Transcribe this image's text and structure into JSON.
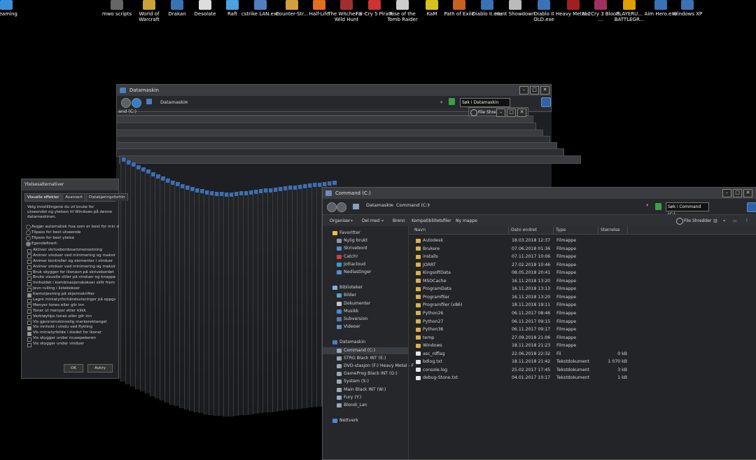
{
  "desktop_icons": [
    {
      "label": "treaming",
      "color": "#3a8fd9"
    },
    {
      "label": "mwo scripts",
      "color": "#666666"
    },
    {
      "label": "World of Warcraft",
      "color": "#c9a23a"
    },
    {
      "label": "Drakan",
      "color": "#3a73b5"
    },
    {
      "label": "Desolate",
      "color": "#dddddd"
    },
    {
      "label": "Raft",
      "color": "#4aa3df"
    },
    {
      "label": "cstrike LAN.exe",
      "color": "#5080c0"
    },
    {
      "label": "Counter-Str...",
      "color": "#d0a040"
    },
    {
      "label": "Half-Life",
      "color": "#e07020"
    },
    {
      "label": "The Witcher 3 - Wild Hunt",
      "color": "#a03030"
    },
    {
      "label": "Far Cry 5 Pirate",
      "color": "#cc3333"
    },
    {
      "label": "Rise of the Tomb Raider",
      "color": "#cccccc"
    },
    {
      "label": "KaM",
      "color": "#d8c020"
    },
    {
      "label": "Path of Exile",
      "color": "#c86020"
    },
    {
      "label": "Diablo II.exe",
      "color": "#3a73b5"
    },
    {
      "label": "Hunt Showdown",
      "color": "#bbbbbb"
    },
    {
      "label": "Diablo II OLD.exe",
      "color": "#3a73b5"
    },
    {
      "label": "Heavy Metal 2",
      "color": "#a02020"
    },
    {
      "label": "Far Cry 3 Blood ...",
      "color": "#a03060"
    },
    {
      "label": "PLAYERU... BATTLEGR...",
      "color": "#e0a000"
    },
    {
      "label": "Aim Hero.exe",
      "color": "#3a73b5"
    },
    {
      "label": "Windows XP",
      "color": "#3a73b5"
    }
  ],
  "performance_dialog": {
    "title": "Ytelsesalternativer",
    "tabs": [
      "Visuelle effekter",
      "Avansert",
      "Datakjøringsforhin"
    ],
    "description": "Velg innstillingene du vil bruke for utseendet og ytelsen til Windows på denne datamaskinen.",
    "radios": [
      "Avgjør automatisk hva som er best for min d",
      "Tilpass for best utseende",
      "Tilpass for best ytelse",
      "Egendefinert:"
    ],
    "options": [
      {
        "label": "Aktiver skrivebordssammensetning",
        "checked": false
      },
      {
        "label": "Animer vinduer ved minimering og maksimering",
        "checked": false
      },
      {
        "label": "Animer kontroller og elementer i vinduer",
        "checked": false
      },
      {
        "label": "Animer vinduer ved minimering og maksimering",
        "checked": false
      },
      {
        "label": "Bruk skygger for ikonavn på skrivebordet",
        "checked": false
      },
      {
        "label": "Bruke visuelle stiler på vinduer og knapper",
        "checked": false
      },
      {
        "label": "Innholdet i kombinasjonsbokser sklîr frem",
        "checked": false
      },
      {
        "label": "Jevn rulling i listebokser",
        "checked": false
      },
      {
        "label": "Kantutjevning på skjermskrifter",
        "checked": true
      },
      {
        "label": "Lagre miniatyrforhåndsvisninger på oppgave",
        "checked": false
      },
      {
        "label": "Menyer tones eller glir inn",
        "checked": false
      },
      {
        "label": "Toner ut menyer etter klikk",
        "checked": false
      },
      {
        "label": "Verktøytips tones eller glir inn",
        "checked": false
      },
      {
        "label": "Vis gjennomskinnelig merkerektangel",
        "checked": false
      },
      {
        "label": "Vis innhold i vindu ved flytting",
        "checked": true
      },
      {
        "label": "Vis miniatyrbilde i stedet for ikoner",
        "checked": true
      },
      {
        "label": "Vis skygger under musepekeren",
        "checked": false
      },
      {
        "label": "Vis skygger under vinduer",
        "checked": false
      }
    ],
    "ok_label": "OK",
    "cancel_label": "Avbry"
  },
  "datamaskin_window": {
    "title": "Datamaskin",
    "breadcrumb": "Datamaskin",
    "search_placeholder": "Søk i Datamaskin",
    "drive_label": "and (C:)"
  },
  "file_shredder_mini": {
    "label": "File Shredder"
  },
  "command_window": {
    "title": "Command (C:)",
    "breadcrumb": [
      "Datamaskin",
      "Command (C:)"
    ],
    "search_placeholder": "Søk i Command (C:)",
    "toolbar": {
      "organize": "Organiser",
      "share": "Del med",
      "burn": "Brenn",
      "compat": "Kompatibilitetsfiler",
      "new_folder": "Ny mappe",
      "shredder": "File Shredder"
    },
    "nav": {
      "favorites_header": "Favoritter",
      "favorites": [
        "Nylig brukt",
        "Skrivebord",
        "Catch!",
        "Jottacloud",
        "Nedlastinger"
      ],
      "libraries_header": "Biblioteker",
      "libraries": [
        "Bilder",
        "Dokumenter",
        "Musikk",
        "Subversion",
        "Videoer"
      ],
      "computer_header": "Datamaskin",
      "drives": [
        "Command (C:)",
        "STRG Black INT (E:)",
        "DVD-stasjon (F:) Heavy Metal - F",
        "GameProg Black INT (G:)",
        "System (S:)",
        "Main Black INT (W:)",
        "Fury (Y:)",
        "Blondi_Lan"
      ],
      "network_header": "Nettverk"
    },
    "columns": {
      "name": "Navn",
      "date": "Dato endret",
      "type": "Type",
      "size": "Størrelse"
    },
    "files": [
      {
        "name": "Autodesk",
        "date": "18.03.2018 12:37",
        "type": "Filmappe",
        "size": "",
        "kind": "folder"
      },
      {
        "name": "Brukere",
        "date": "07.06.2018 01:36",
        "type": "Filmappe",
        "size": "",
        "kind": "folder"
      },
      {
        "name": "installs",
        "date": "07.11.2017 10:06",
        "type": "Filmappe",
        "size": "",
        "kind": "folder"
      },
      {
        "name": "JORRT",
        "date": "27.02.2018 10:46",
        "type": "Filmappe",
        "size": "",
        "kind": "folder"
      },
      {
        "name": "KingsoftData",
        "date": "08.05.2018 20:41",
        "type": "Filmappe",
        "size": "",
        "kind": "folder"
      },
      {
        "name": "MSOCache",
        "date": "16.11.2018 13:20",
        "type": "Filmappe",
        "size": "",
        "kind": "folder"
      },
      {
        "name": "ProgramData",
        "date": "16.11.2018 13:13",
        "type": "Filmappe",
        "size": "",
        "kind": "folder"
      },
      {
        "name": "Programfiler",
        "date": "16.11.2018 13:20",
        "type": "Filmappe",
        "size": "",
        "kind": "folder"
      },
      {
        "name": "Programfiler (x86)",
        "date": "18.11.2018 19:11",
        "type": "Filmappe",
        "size": "",
        "kind": "folder"
      },
      {
        "name": "Python26",
        "date": "06.11.2017 08:46",
        "type": "Filmappe",
        "size": "",
        "kind": "folder"
      },
      {
        "name": "Python27",
        "date": "06.11.2017 09:15",
        "type": "Filmappe",
        "size": "",
        "kind": "folder"
      },
      {
        "name": "Python36",
        "date": "06.11.2017 09:17",
        "type": "Filmappe",
        "size": "",
        "kind": "folder"
      },
      {
        "name": "temp",
        "date": "27.09.2018 21:06",
        "type": "Filmappe",
        "size": "",
        "kind": "folder"
      },
      {
        "name": "Windows",
        "date": "18.11.2018 21:23",
        "type": "Filmappe",
        "size": "",
        "kind": "folder"
      },
      {
        "name": "asc_rdflag",
        "date": "22.06.2018 22:32",
        "type": "Fil",
        "size": "0 kB",
        "kind": "file"
      },
      {
        "name": "bdlog.txt",
        "date": "18.11.2018 21:42",
        "type": "Tekstdokument",
        "size": "1 070 kB",
        "kind": "file"
      },
      {
        "name": "console.log",
        "date": "25.02.2017 17:45",
        "type": "Tekstdokument",
        "size": "3 kB",
        "kind": "file"
      },
      {
        "name": "debug-Stone.txt",
        "date": "04.01.2017 10:17",
        "type": "Tekstdokument",
        "size": "1 kB",
        "kind": "file"
      }
    ]
  }
}
